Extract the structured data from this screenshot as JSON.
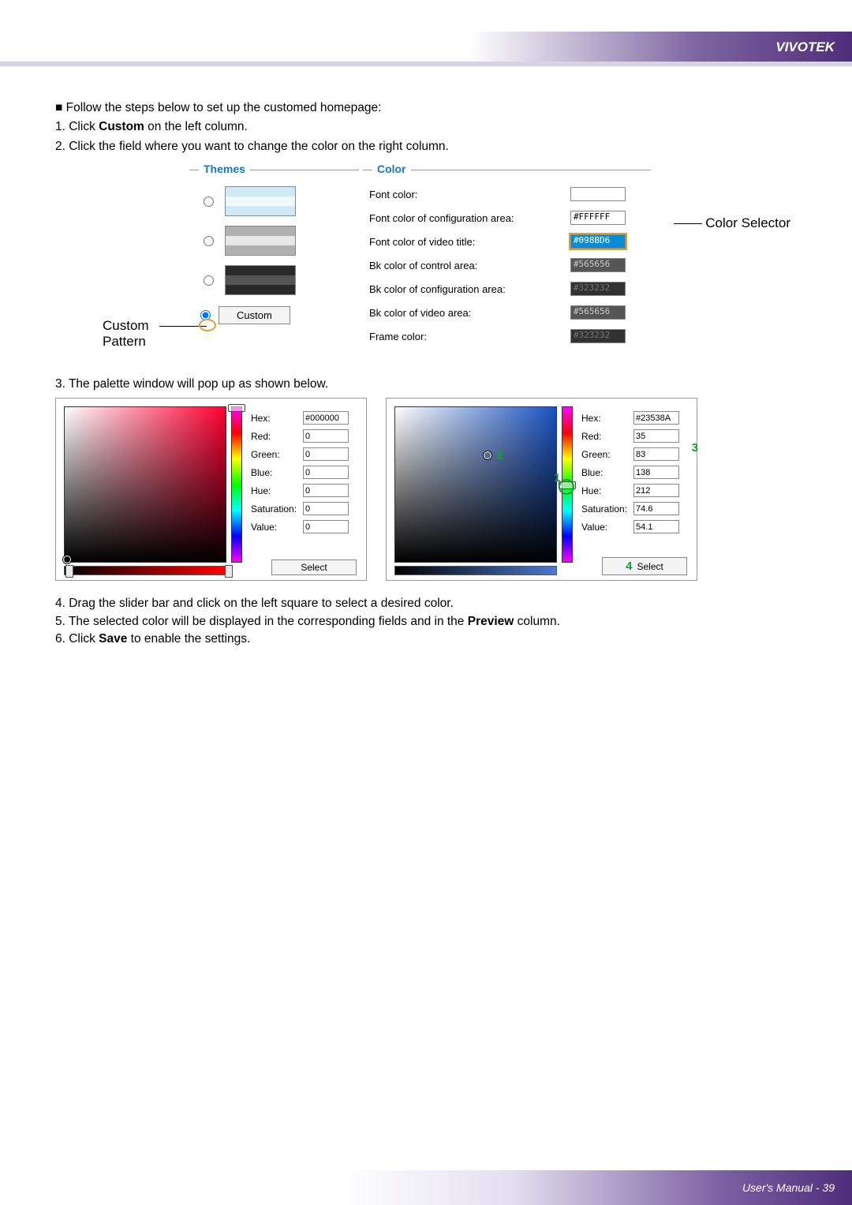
{
  "brand": "VIVOTEK",
  "intro": {
    "bullet": "■ Follow the steps below to set up the customed homepage:",
    "step1_a": "1. Click ",
    "step1_b": "Custom",
    "step1_c": " on the left column.",
    "step2": "2. Click the field where you want to change the color on the right column."
  },
  "callouts": {
    "custom_pattern": "Custom Pattern",
    "color_selector": "Color Selector"
  },
  "themes": {
    "legend": "Themes",
    "custom_label": "Custom"
  },
  "color_panel": {
    "legend": "Color",
    "rows": [
      {
        "label": "Font color:",
        "value": "",
        "bg": "#ffffff",
        "fg": "#000"
      },
      {
        "label": "Font color of configuration area:",
        "value": "#FFFFFF",
        "bg": "#ffffff",
        "fg": "#000"
      },
      {
        "label": "Font color of video title:",
        "value": "#098BD6",
        "bg": "#098BD6",
        "fg": "#fff",
        "selected": true
      },
      {
        "label": "Bk color of control area:",
        "value": "#565656",
        "bg": "#565656",
        "fg": "#ddd"
      },
      {
        "label": "Bk color of configuration area:",
        "value": "#323232",
        "bg": "#323232",
        "fg": "#888"
      },
      {
        "label": "Bk color of video area:",
        "value": "#565656",
        "bg": "#565656",
        "fg": "#ddd"
      },
      {
        "label": "Frame color:",
        "value": "#323232",
        "bg": "#323232",
        "fg": "#888"
      }
    ]
  },
  "step3": "3. The palette window will pop up as shown below.",
  "palette_labels": {
    "hex": "Hex:",
    "red": "Red:",
    "green": "Green:",
    "blue": "Blue:",
    "hue": "Hue:",
    "saturation": "Saturation:",
    "value": "Value:",
    "select": "Select"
  },
  "palette_left": {
    "hex": "#000000",
    "red": "0",
    "green": "0",
    "blue": "0",
    "hue": "0",
    "saturation": "0",
    "value": "0"
  },
  "palette_right": {
    "hex": "#23538A",
    "red": "35",
    "green": "83",
    "blue": "138",
    "hue": "212",
    "saturation": "74.6",
    "value": "54.1"
  },
  "annotations": {
    "n1": "1",
    "n2": "2",
    "n3": "3",
    "n4": "4"
  },
  "steps_bottom": {
    "s4": "4. Drag the slider bar and click on the left square to select a desired color.",
    "s5_a": "5. The selected color will be displayed in the corresponding fields and in the ",
    "s5_b": "Preview",
    "s5_c": " column.",
    "s6_a": "6. Click ",
    "s6_b": "Save",
    "s6_c": " to enable the settings."
  },
  "footer": {
    "manual": "User's Manual - ",
    "page": "39"
  }
}
